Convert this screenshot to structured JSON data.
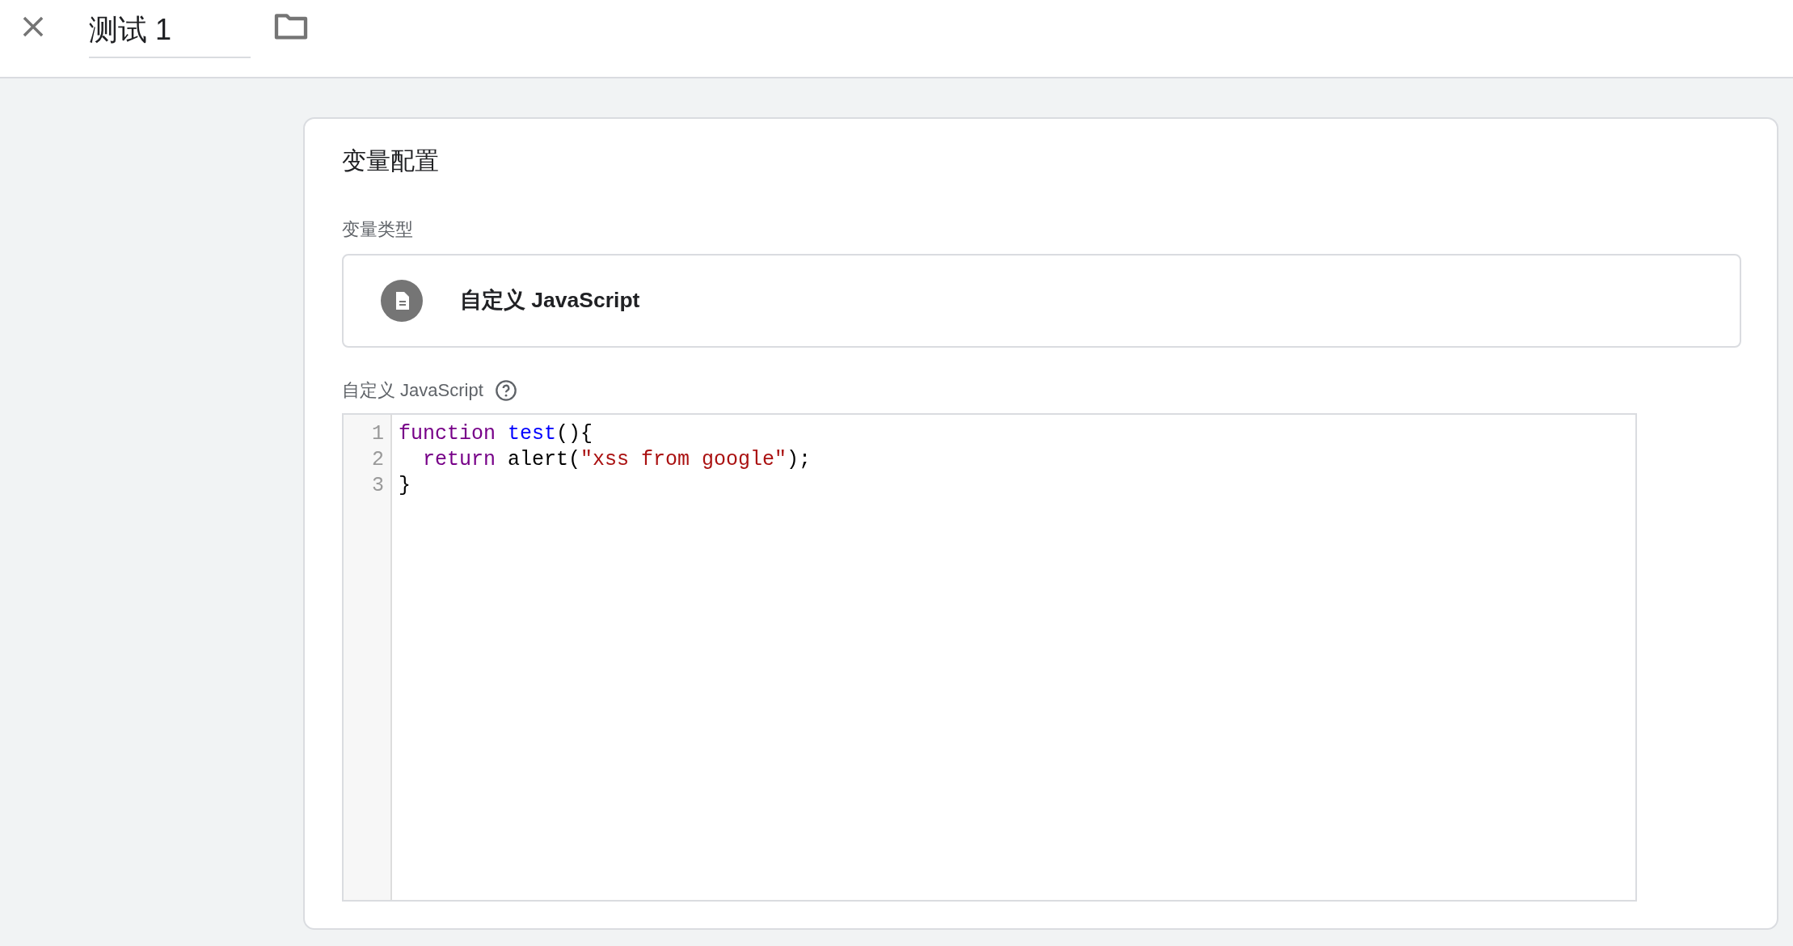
{
  "header": {
    "title_value": "测试 1"
  },
  "card": {
    "heading": "变量配置",
    "type_label": "变量类型",
    "type_name": "自定义 JavaScript",
    "code_label": "自定义 JavaScript",
    "code_lines": [
      {
        "number": "1",
        "tokens": [
          {
            "kind": "keyword",
            "text": "function "
          },
          {
            "kind": "def",
            "text": "test"
          },
          {
            "kind": "plain",
            "text": "(){"
          }
        ]
      },
      {
        "number": "2",
        "tokens": [
          {
            "kind": "keyword",
            "text": "  return"
          },
          {
            "kind": "plain",
            "text": " alert("
          },
          {
            "kind": "string",
            "text": "\"xss from google\""
          },
          {
            "kind": "plain",
            "text": ");"
          }
        ]
      },
      {
        "number": "3",
        "tokens": [
          {
            "kind": "plain",
            "text": "}"
          }
        ]
      }
    ]
  }
}
